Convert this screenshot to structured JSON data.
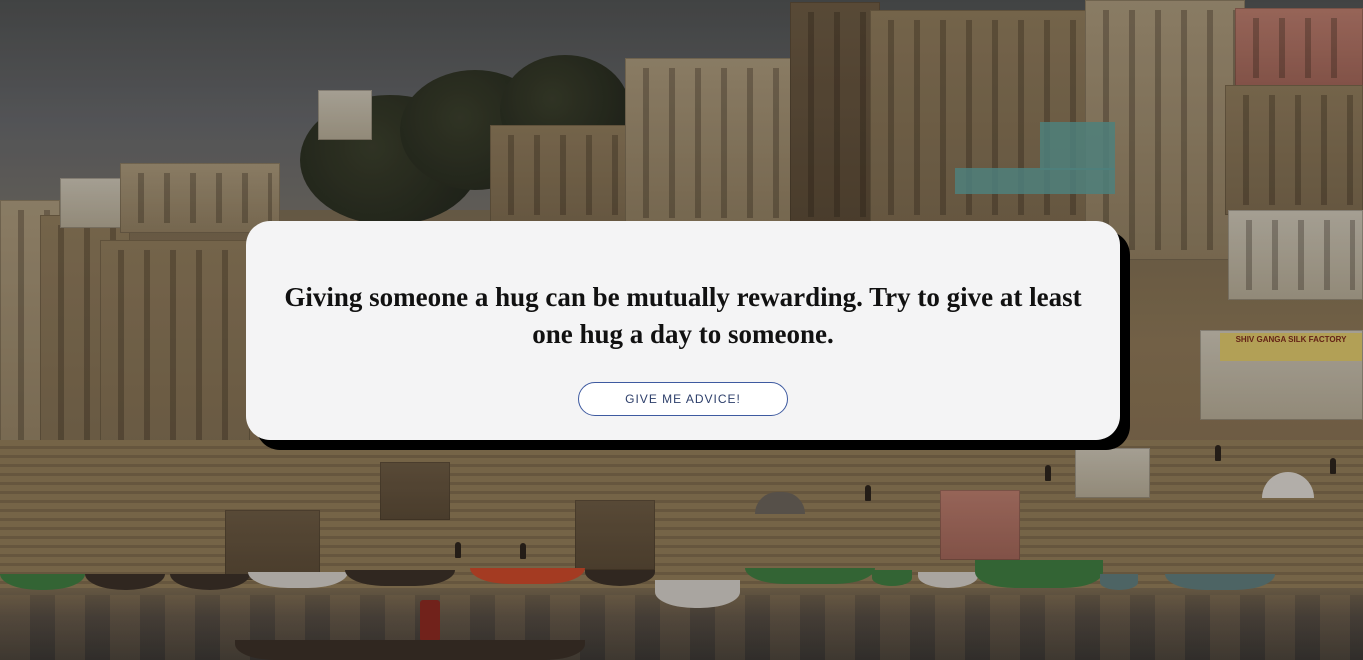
{
  "page": {
    "background_description_icon": "city-ghat-photo"
  },
  "card": {
    "advice_text": "Giving someone a hug can be mutually rewarding. Try to give at least one hug a day to someone.",
    "button_label": "GIVE ME ADVICE!"
  },
  "scene": {
    "sign_text": "SHIV GANGA SILK FACTORY"
  },
  "colors": {
    "card_background": "#f4f4f5",
    "card_shadow": "#000000",
    "button_border": "#3e5aa0",
    "button_text": "#2c3e6a"
  }
}
